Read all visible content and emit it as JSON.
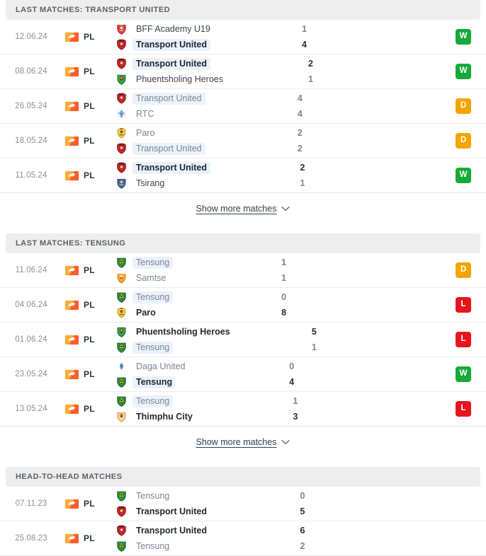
{
  "sections": [
    {
      "id": "last-matches-transport-united",
      "title": "LAST MATCHES: TRANSPORT UNITED",
      "show_more_label": "Show more matches",
      "has_show_more": true,
      "matches": [
        {
          "date": "12.06.24",
          "competition": "PL",
          "flag": "bhutan-flag-icon",
          "home": {
            "name": "BFF Academy U19",
            "crest": "bff-academy-u19-crest-icon",
            "bold": false,
            "dim": false,
            "highlight": false
          },
          "away": {
            "name": "Transport United",
            "crest": "transport-united-crest-icon",
            "bold": true,
            "dim": false,
            "highlight": true
          },
          "home_score": "1",
          "away_score": "4",
          "home_score_dim": true,
          "away_score_dim": false,
          "result": "W"
        },
        {
          "date": "08.06.24",
          "competition": "PL",
          "flag": "bhutan-flag-icon",
          "home": {
            "name": "Transport United",
            "crest": "transport-united-crest-icon",
            "bold": true,
            "dim": false,
            "highlight": true
          },
          "away": {
            "name": "Phuentsholing Heroes",
            "crest": "phuentsholing-heroes-crest-icon",
            "bold": false,
            "dim": false,
            "highlight": false
          },
          "home_score": "2",
          "away_score": "1",
          "home_score_dim": false,
          "away_score_dim": true,
          "result": "W"
        },
        {
          "date": "26.05.24",
          "competition": "PL",
          "flag": "bhutan-flag-icon",
          "home": {
            "name": "Transport United",
            "crest": "transport-united-crest-icon",
            "bold": false,
            "dim": true,
            "highlight": true
          },
          "away": {
            "name": "RTC",
            "crest": "rtc-crest-icon",
            "bold": false,
            "dim": true,
            "highlight": false
          },
          "home_score": "4",
          "away_score": "4",
          "home_score_dim": true,
          "away_score_dim": true,
          "result": "D"
        },
        {
          "date": "18.05.24",
          "competition": "PL",
          "flag": "bhutan-flag-icon",
          "home": {
            "name": "Paro",
            "crest": "paro-crest-icon",
            "bold": false,
            "dim": true,
            "highlight": false
          },
          "away": {
            "name": "Transport United",
            "crest": "transport-united-crest-icon",
            "bold": false,
            "dim": true,
            "highlight": true
          },
          "home_score": "2",
          "away_score": "2",
          "home_score_dim": true,
          "away_score_dim": true,
          "result": "D"
        },
        {
          "date": "11.05.24",
          "competition": "PL",
          "flag": "bhutan-flag-icon",
          "home": {
            "name": "Transport United",
            "crest": "transport-united-crest-icon",
            "bold": true,
            "dim": false,
            "highlight": true
          },
          "away": {
            "name": "Tsirang",
            "crest": "tsirang-crest-icon",
            "bold": false,
            "dim": false,
            "highlight": false
          },
          "home_score": "2",
          "away_score": "1",
          "home_score_dim": false,
          "away_score_dim": true,
          "result": "W"
        }
      ]
    },
    {
      "id": "last-matches-tensung",
      "title": "LAST MATCHES: TENSUNG",
      "show_more_label": "Show more matches",
      "has_show_more": true,
      "matches": [
        {
          "date": "11.06.24",
          "competition": "PL",
          "flag": "bhutan-flag-icon",
          "home": {
            "name": "Tensung",
            "crest": "tensung-crest-icon",
            "bold": false,
            "dim": true,
            "highlight": true
          },
          "away": {
            "name": "Samtse",
            "crest": "samtse-crest-icon",
            "bold": false,
            "dim": true,
            "highlight": false
          },
          "home_score": "1",
          "away_score": "1",
          "home_score_dim": true,
          "away_score_dim": true,
          "result": "D"
        },
        {
          "date": "04.06.24",
          "competition": "PL",
          "flag": "bhutan-flag-icon",
          "home": {
            "name": "Tensung",
            "crest": "tensung-crest-icon",
            "bold": false,
            "dim": true,
            "highlight": true
          },
          "away": {
            "name": "Paro",
            "crest": "paro-crest-icon",
            "bold": true,
            "dim": false,
            "highlight": false
          },
          "home_score": "0",
          "away_score": "8",
          "home_score_dim": true,
          "away_score_dim": false,
          "result": "L"
        },
        {
          "date": "01.06.24",
          "competition": "PL",
          "flag": "bhutan-flag-icon",
          "home": {
            "name": "Phuentsholing Heroes",
            "crest": "phuentsholing-heroes-crest-icon",
            "bold": true,
            "dim": false,
            "highlight": false
          },
          "away": {
            "name": "Tensung",
            "crest": "tensung-crest-icon",
            "bold": false,
            "dim": true,
            "highlight": true
          },
          "home_score": "5",
          "away_score": "1",
          "home_score_dim": false,
          "away_score_dim": true,
          "result": "L"
        },
        {
          "date": "23.05.24",
          "competition": "PL",
          "flag": "bhutan-flag-icon",
          "home": {
            "name": "Daga United",
            "crest": "daga-united-crest-icon",
            "bold": false,
            "dim": true,
            "highlight": false
          },
          "away": {
            "name": "Tensung",
            "crest": "tensung-crest-icon",
            "bold": true,
            "dim": false,
            "highlight": true
          },
          "home_score": "0",
          "away_score": "4",
          "home_score_dim": true,
          "away_score_dim": false,
          "result": "W"
        },
        {
          "date": "13.05.24",
          "competition": "PL",
          "flag": "bhutan-flag-icon",
          "home": {
            "name": "Tensung",
            "crest": "tensung-crest-icon",
            "bold": false,
            "dim": true,
            "highlight": true
          },
          "away": {
            "name": "Thimphu City",
            "crest": "thimphu-city-crest-icon",
            "bold": true,
            "dim": false,
            "highlight": false
          },
          "home_score": "1",
          "away_score": "3",
          "home_score_dim": true,
          "away_score_dim": false,
          "result": "L"
        }
      ]
    },
    {
      "id": "head-to-head-matches",
      "title": "HEAD-TO-HEAD MATCHES",
      "show_more_label": "",
      "has_show_more": false,
      "matches": [
        {
          "date": "07.11.23",
          "competition": "PL",
          "flag": "bhutan-flag-icon",
          "home": {
            "name": "Tensung",
            "crest": "tensung-crest-icon",
            "bold": false,
            "dim": true,
            "highlight": false
          },
          "away": {
            "name": "Transport United",
            "crest": "transport-united-crest-icon",
            "bold": true,
            "dim": false,
            "highlight": false
          },
          "home_score": "0",
          "away_score": "5",
          "home_score_dim": true,
          "away_score_dim": false,
          "result": ""
        },
        {
          "date": "25.08.23",
          "competition": "PL",
          "flag": "bhutan-flag-icon",
          "home": {
            "name": "Transport United",
            "crest": "transport-united-crest-icon",
            "bold": true,
            "dim": false,
            "highlight": false
          },
          "away": {
            "name": "Tensung",
            "crest": "tensung-crest-icon",
            "bold": false,
            "dim": true,
            "highlight": false
          },
          "home_score": "6",
          "away_score": "2",
          "home_score_dim": false,
          "away_score_dim": true,
          "result": ""
        }
      ]
    }
  ],
  "colors": {
    "win": "#17a939",
    "draw": "#f5a300",
    "loss": "#e8141b",
    "header_bg": "#eeeeee",
    "highlight_bg": "#eaf2fd"
  }
}
